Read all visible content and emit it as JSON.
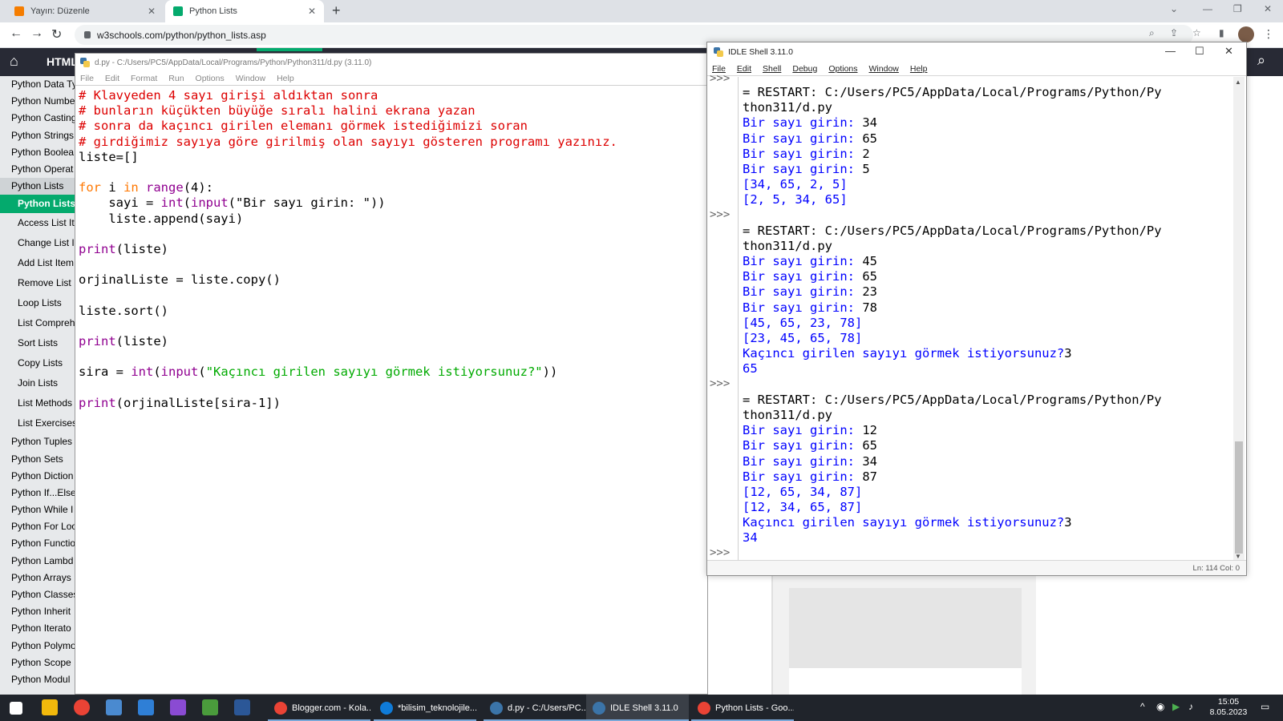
{
  "browser": {
    "tabs": [
      {
        "title": "Yayın: Düzenle",
        "active": false
      },
      {
        "title": "Python Lists",
        "active": true
      }
    ],
    "url": "w3schools.com/python/python_lists.asp"
  },
  "w3": {
    "nav_html": "HTML",
    "sidebar": [
      {
        "label": "Python Data Ty",
        "type": "item"
      },
      {
        "label": "Python Numbe",
        "type": "item"
      },
      {
        "label": "Python Casting",
        "type": "item"
      },
      {
        "label": "Python Strings",
        "type": "item"
      },
      {
        "label": "Python Boolea",
        "type": "item"
      },
      {
        "label": "Python Operat",
        "type": "item"
      },
      {
        "label": "Python Lists",
        "type": "group"
      },
      {
        "label": "Python Lists",
        "type": "active"
      },
      {
        "label": "Access List It",
        "type": "sub"
      },
      {
        "label": "Change List I",
        "type": "sub"
      },
      {
        "label": "Add List Item",
        "type": "sub"
      },
      {
        "label": "Remove List",
        "type": "sub"
      },
      {
        "label": "Loop Lists",
        "type": "sub"
      },
      {
        "label": "List Compreh",
        "type": "sub"
      },
      {
        "label": "Sort Lists",
        "type": "sub"
      },
      {
        "label": "Copy Lists",
        "type": "sub"
      },
      {
        "label": "Join Lists",
        "type": "sub"
      },
      {
        "label": "List Methods",
        "type": "sub"
      },
      {
        "label": "List Exercises",
        "type": "sub"
      },
      {
        "label": "Python Tuples",
        "type": "item"
      },
      {
        "label": "Python Sets",
        "type": "item"
      },
      {
        "label": "Python Diction",
        "type": "item"
      },
      {
        "label": "Python If...Else",
        "type": "item"
      },
      {
        "label": "Python While I",
        "type": "item"
      },
      {
        "label": "Python For Loo",
        "type": "item"
      },
      {
        "label": "Python Functio",
        "type": "item"
      },
      {
        "label": "Python Lambd",
        "type": "item"
      },
      {
        "label": "Python Arrays",
        "type": "item"
      },
      {
        "label": "Python Classes",
        "type": "item"
      },
      {
        "label": "Python Inherit",
        "type": "item"
      },
      {
        "label": "Python Iterato",
        "type": "item"
      },
      {
        "label": "Python Polymo",
        "type": "item"
      },
      {
        "label": "Python Scope",
        "type": "item"
      },
      {
        "label": "Python Modul",
        "type": "item"
      }
    ]
  },
  "editor": {
    "title": "d.py - C:/Users/PC5/AppData/Local/Programs/Python/Python311/d.py (3.11.0)",
    "menu": [
      "File",
      "Edit",
      "Format",
      "Run",
      "Options",
      "Window",
      "Help"
    ],
    "code": [
      [
        {
          "t": "# Klavyeden 4 sayı girişi aldıktan sonra",
          "c": "cm"
        }
      ],
      [
        {
          "t": "# bunların küçükten büyüğe sıralı halini ekrana yazan",
          "c": "cm"
        }
      ],
      [
        {
          "t": "# sonra da kaçıncı girilen elemanı görmek istediğimizi soran",
          "c": "cm"
        }
      ],
      [
        {
          "t": "# girdiğimiz sayıya göre girilmiş olan sayıyı gösteren programı yazınız.",
          "c": "cm"
        }
      ],
      [
        {
          "t": "liste=[]",
          "c": ""
        }
      ],
      [],
      [
        {
          "t": "for",
          "c": "kw"
        },
        {
          "t": " i ",
          "c": ""
        },
        {
          "t": "in",
          "c": "kw"
        },
        {
          "t": " ",
          "c": ""
        },
        {
          "t": "range",
          "c": "bi"
        },
        {
          "t": "(4):",
          "c": ""
        }
      ],
      [
        {
          "t": "    sayi = ",
          "c": ""
        },
        {
          "t": "int",
          "c": "bi"
        },
        {
          "t": "(",
          "c": ""
        },
        {
          "t": "input",
          "c": "bi"
        },
        {
          "t": "(\"Bir sayı girin: \"))",
          "c": ""
        }
      ],
      [
        {
          "t": "    liste.append(sayi)",
          "c": ""
        }
      ],
      [],
      [
        {
          "t": "print",
          "c": "bi"
        },
        {
          "t": "(liste)",
          "c": ""
        }
      ],
      [],
      [
        {
          "t": "orjinalListe = liste.copy()",
          "c": ""
        }
      ],
      [],
      [
        {
          "t": "liste.sort()",
          "c": ""
        }
      ],
      [],
      [
        {
          "t": "print",
          "c": "bi"
        },
        {
          "t": "(liste)",
          "c": ""
        }
      ],
      [],
      [
        {
          "t": "sira = ",
          "c": ""
        },
        {
          "t": "int",
          "c": "bi"
        },
        {
          "t": "(",
          "c": ""
        },
        {
          "t": "input",
          "c": "bi"
        },
        {
          "t": "(",
          "c": ""
        },
        {
          "t": "\"Kaçıncı girilen sayıyı görmek istiyorsunuz?\"",
          "c": "st"
        },
        {
          "t": "))",
          "c": ""
        }
      ],
      [],
      [
        {
          "t": "print",
          "c": "bi"
        },
        {
          "t": "(orjinalListe[sira-1])",
          "c": ""
        }
      ]
    ]
  },
  "shell": {
    "title": "IDLE Shell 3.11.0",
    "menu": [
      "File",
      "Edit",
      "Shell",
      "Debug",
      "Options",
      "Window",
      "Help"
    ],
    "prompt": ">>>",
    "lines": [
      {
        "t": "= RESTART: C:/Users/PC5/AppData/Local/Programs/Python/Py",
        "c": "",
        "p": true
      },
      {
        "t": "thon311/d.py",
        "c": ""
      },
      {
        "t": "Bir sayı girin: ",
        "c": "out",
        "v": "34"
      },
      {
        "t": "Bir sayı girin: ",
        "c": "out",
        "v": "65"
      },
      {
        "t": "Bir sayı girin: ",
        "c": "out",
        "v": "2"
      },
      {
        "t": "Bir sayı girin: ",
        "c": "out",
        "v": "5"
      },
      {
        "t": "[34, 65, 2, 5]",
        "c": "out"
      },
      {
        "t": "[2, 5, 34, 65]",
        "c": "out"
      },
      {
        "t": "",
        "c": "",
        "p": true
      },
      {
        "t": "= RESTART: C:/Users/PC5/AppData/Local/Programs/Python/Py",
        "c": ""
      },
      {
        "t": "thon311/d.py",
        "c": ""
      },
      {
        "t": "Bir sayı girin: ",
        "c": "out",
        "v": "45"
      },
      {
        "t": "Bir sayı girin: ",
        "c": "out",
        "v": "65"
      },
      {
        "t": "Bir sayı girin: ",
        "c": "out",
        "v": "23"
      },
      {
        "t": "Bir sayı girin: ",
        "c": "out",
        "v": "78"
      },
      {
        "t": "[45, 65, 23, 78]",
        "c": "out"
      },
      {
        "t": "[23, 45, 65, 78]",
        "c": "out"
      },
      {
        "t": "Kaçıncı girilen sayıyı görmek istiyorsunuz?",
        "c": "out",
        "v": "3"
      },
      {
        "t": "65",
        "c": "out"
      },
      {
        "t": "",
        "c": "",
        "p": true
      },
      {
        "t": "= RESTART: C:/Users/PC5/AppData/Local/Programs/Python/Py",
        "c": ""
      },
      {
        "t": "thon311/d.py",
        "c": ""
      },
      {
        "t": "Bir sayı girin: ",
        "c": "out",
        "v": "12"
      },
      {
        "t": "Bir sayı girin: ",
        "c": "out",
        "v": "65"
      },
      {
        "t": "Bir sayı girin: ",
        "c": "out",
        "v": "34"
      },
      {
        "t": "Bir sayı girin: ",
        "c": "out",
        "v": "87"
      },
      {
        "t": "[12, 65, 34, 87]",
        "c": "out"
      },
      {
        "t": "[12, 34, 65, 87]",
        "c": "out"
      },
      {
        "t": "Kaçıncı girilen sayıyı görmek istiyorsunuz?",
        "c": "out",
        "v": "3"
      },
      {
        "t": "34",
        "c": "out"
      },
      {
        "t": "",
        "c": "",
        "p": true
      }
    ],
    "status": "Ln: 114   Col: 0"
  },
  "taskbar": {
    "apps": [
      {
        "label": "Blogger.com - Kola...",
        "icon_color": "#ea4335",
        "active": false
      },
      {
        "label": "*bilisim_teknolojile...",
        "icon_color": "#0f7bd8",
        "active": false
      },
      {
        "label": "d.py - C:/Users/PC...",
        "icon_color": "#3b74a8",
        "active": false
      },
      {
        "label": "IDLE Shell 3.11.0",
        "icon_color": "#3b74a8",
        "active": true
      },
      {
        "label": "Python Lists - Goo...",
        "icon_color": "#ea4335",
        "active": false
      }
    ],
    "time": "15:05",
    "date": "8.05.2023"
  },
  "colors": {
    "comment": "#dd0000",
    "keyword": "#ff7700",
    "builtin": "#900090",
    "string": "#00aa00",
    "shell_output": "#0000ff",
    "w3_green": "#04aa6d",
    "w3_dark": "#282a35"
  }
}
